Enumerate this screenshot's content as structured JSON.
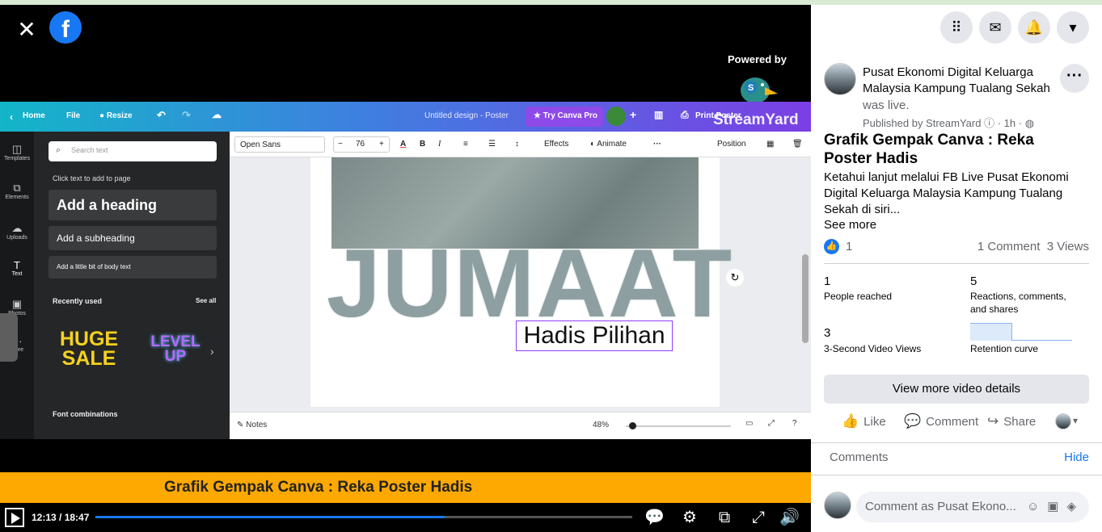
{
  "player": {
    "powered_by": "Powered by",
    "streamyard": "StreamYard"
  },
  "canva": {
    "home": "Home",
    "file": "File",
    "resize": "Resize",
    "doc_title": "Untitled design - Poster",
    "try_pro": "Try Canva Pro",
    "print": "Print Poster",
    "sidebar": [
      "Templates",
      "Elements",
      "Uploads",
      "Text",
      "Photos",
      "More"
    ],
    "search_placeholder": "Search text",
    "click_text": "Click text to add to page",
    "add_heading": "Add a heading",
    "add_subheading": "Add a subheading",
    "add_body": "Add a little bit of body text",
    "recently_used": "Recently used",
    "see_all": "See all",
    "huge_sale": "HUGE SALE",
    "level_up": "LEVEL UP",
    "font_combinations": "Font combinations",
    "font": "Open Sans",
    "font_size": "76",
    "effects": "Effects",
    "animate": "Animate",
    "position": "Position",
    "poster_word": "JUMAAT",
    "poster_text": "Hadis Pilihan",
    "notes": "Notes",
    "zoom": "48%"
  },
  "banner": "Grafik Gempak Canva : Reka Poster Hadis",
  "controls": {
    "time": "12:13 / 18:47",
    "progress": 0.65
  },
  "post": {
    "page_name": "Pusat Ekonomi Digital Keluarga Malaysia Kampung Tualang Sekah",
    "was_live": "was live.",
    "published": "Published by StreamYard",
    "when": "· 1h ·",
    "title": "Grafik Gempak Canva : Reka Poster Hadis",
    "description": "Ketahui lanjut melalui FB Live Pusat Ekonomi Digital Keluarga Malaysia Kampung Tualang Sekah di siri...",
    "see_more": "See more",
    "likes": "1",
    "comments_count": "1 Comment",
    "views": "3 Views",
    "stats": [
      {
        "num": "1",
        "label": "People reached"
      },
      {
        "num": "5",
        "label": "Reactions, comments, and shares"
      },
      {
        "num": "3",
        "label": "3-Second Video Views"
      },
      {
        "num": "",
        "label": "Retention curve"
      }
    ],
    "view_more": "View more video details",
    "like": "Like",
    "comment": "Comment",
    "share": "Share",
    "comments_label": "Comments",
    "hide": "Hide",
    "comment_placeholder": "Comment as Pusat Ekono..."
  },
  "colors": {
    "facebook_blue": "#1877f2",
    "banner": "#fda901"
  }
}
